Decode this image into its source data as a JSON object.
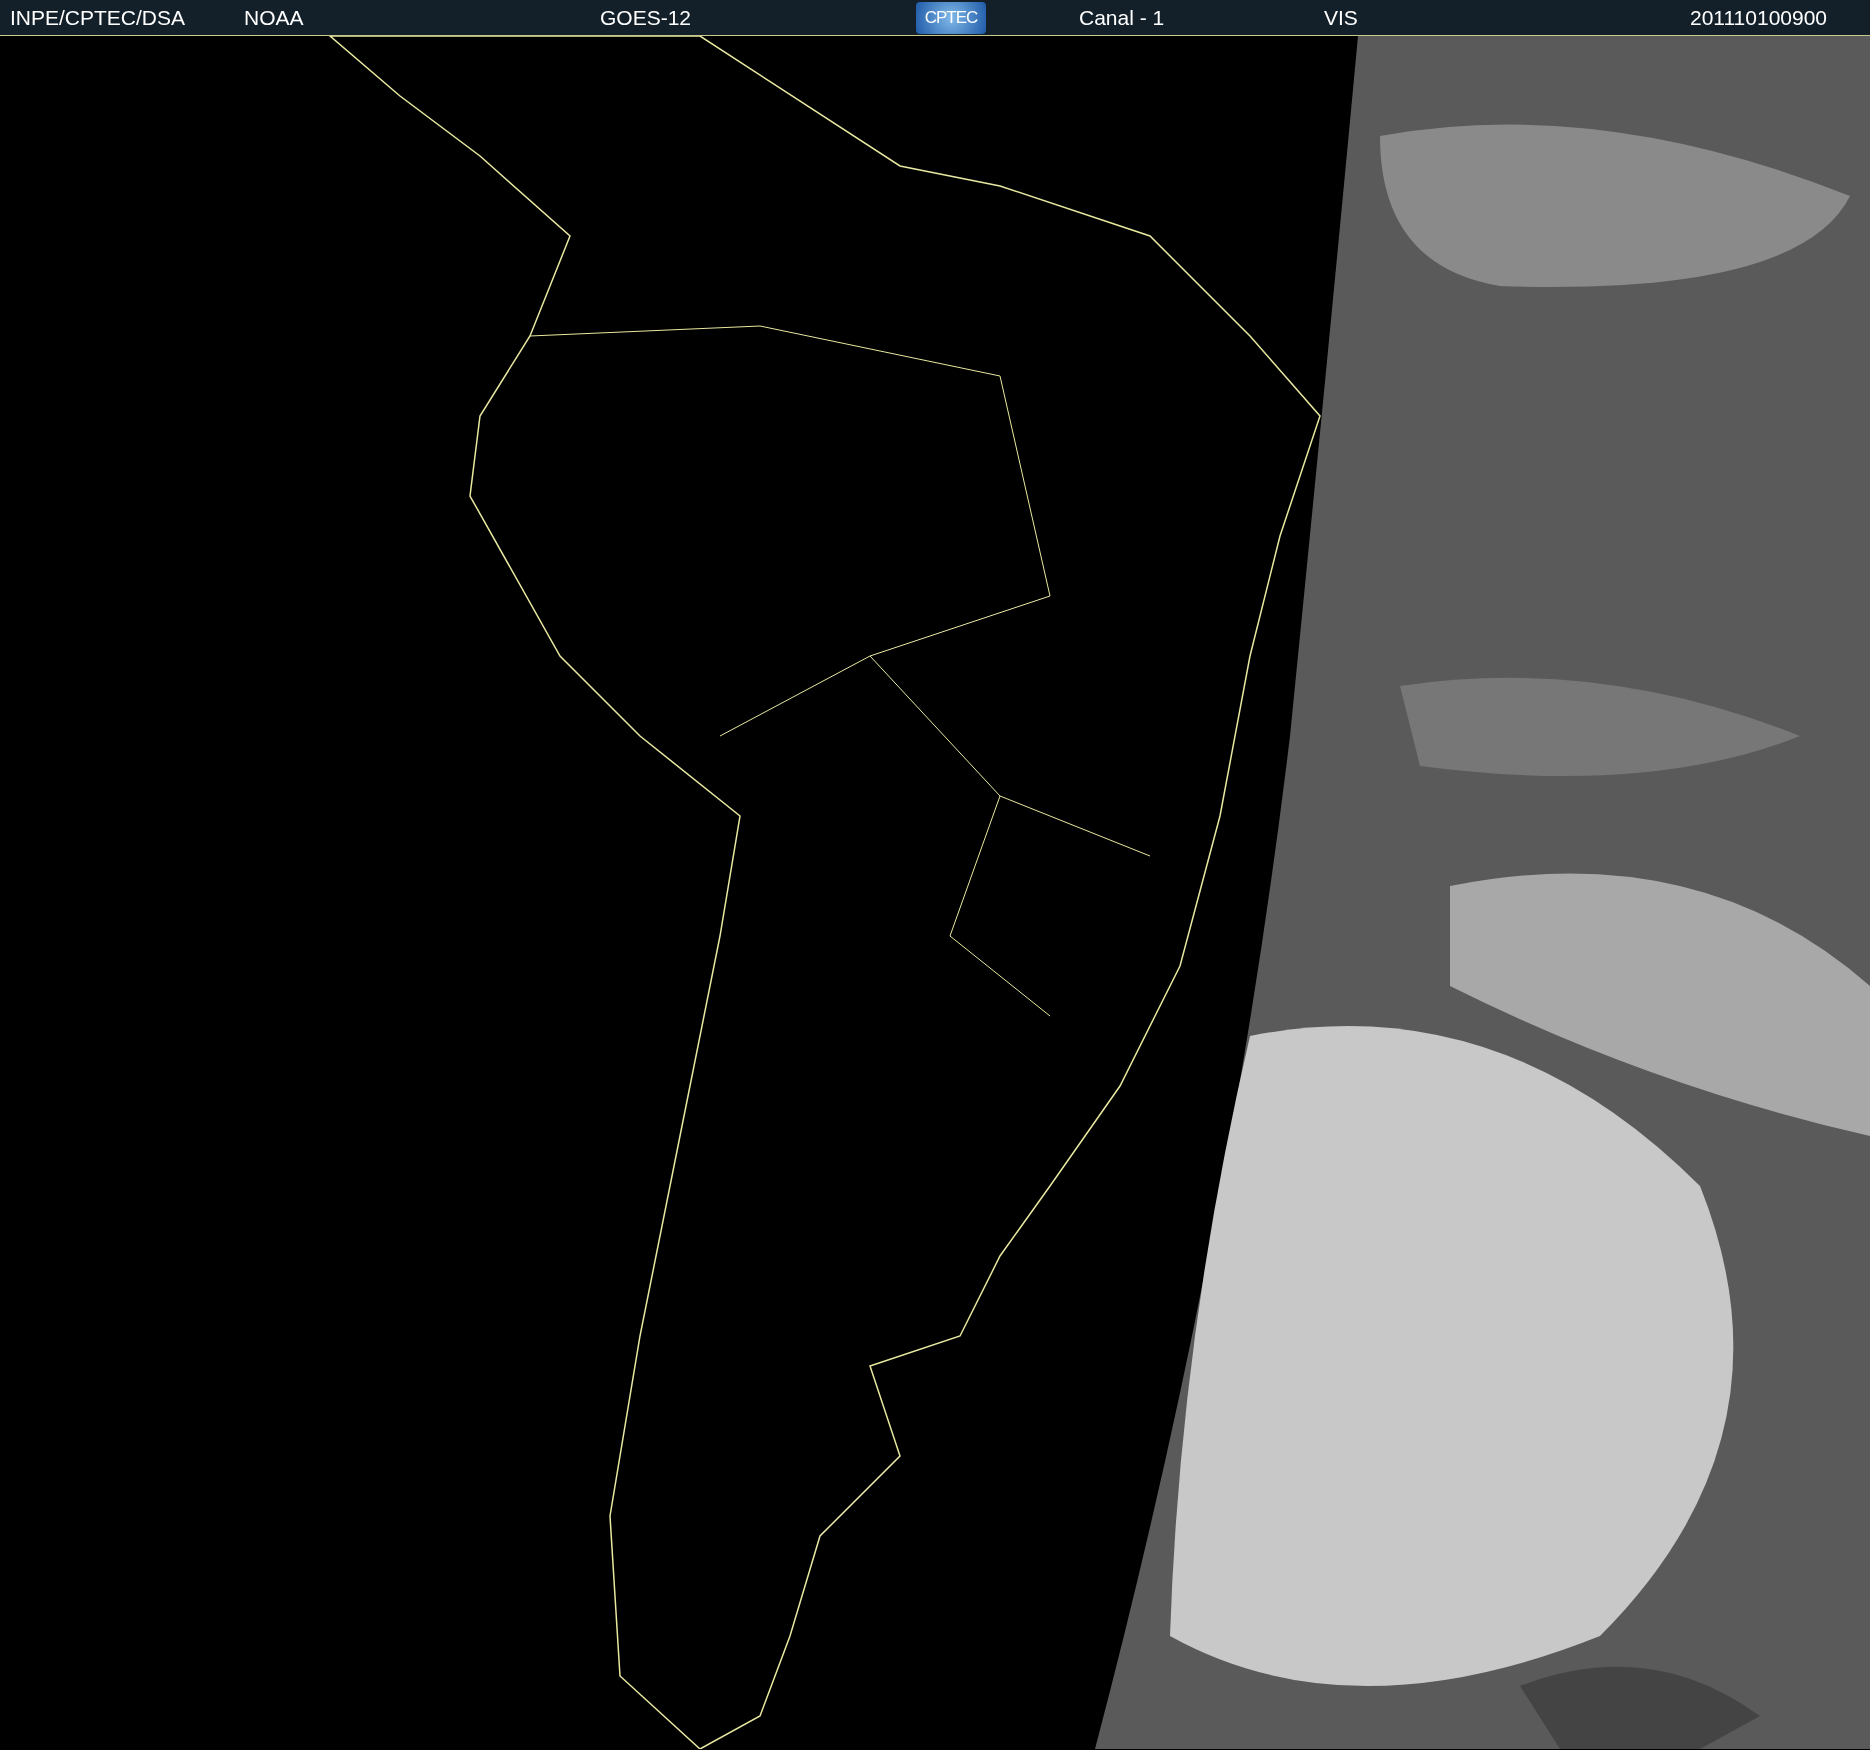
{
  "header": [
    {
      "kind": "text",
      "text": "INPE/CPTEC/DSA"
    },
    {
      "kind": "text",
      "text": "NOAA"
    },
    {
      "kind": "text",
      "text": "GOES-12"
    },
    {
      "kind": "logo",
      "text": "CPTEC"
    },
    {
      "kind": "text",
      "text": "Canal - 1"
    },
    {
      "kind": "text",
      "text": "VIS"
    },
    {
      "kind": "text",
      "text": "201110100900"
    }
  ]
}
